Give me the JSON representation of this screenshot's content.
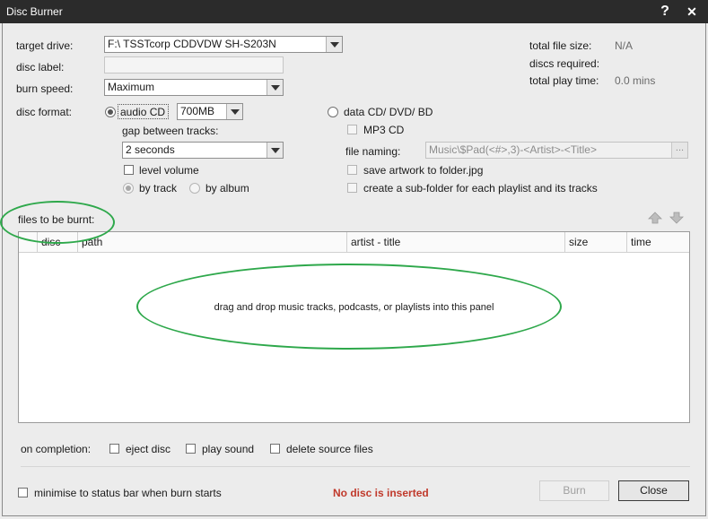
{
  "window": {
    "title": "Disc Burner",
    "help_label": "?",
    "close_label": "✕"
  },
  "left": {
    "target_drive_label": "target drive:",
    "target_drive_value": "F:\\ TSSTcorp CDDVDW SH-S203N",
    "disc_label_label": "disc label:",
    "disc_label_value": "",
    "burn_speed_label": "burn speed:",
    "burn_speed_value": "Maximum",
    "disc_format_label": "disc format:",
    "audio_cd_label": "audio CD",
    "audio_cd_size": "700MB",
    "gap_label": "gap between tracks:",
    "gap_value": "2 seconds",
    "level_volume_label": "level volume",
    "by_track_label": "by track",
    "by_album_label": "by album"
  },
  "right": {
    "total_file_size_label": "total file size:",
    "total_file_size_value": "N/A",
    "discs_required_label": "discs required:",
    "discs_required_value": "",
    "total_play_time_label": "total play time:",
    "total_play_time_value": "0.0 mins",
    "data_cd_label": "data CD/ DVD/ BD",
    "mp3_cd_label": "MP3 CD",
    "file_naming_label": "file naming:",
    "file_naming_value": "Music\\$Pad(<#>,3)-<Artist>-<Title>",
    "file_naming_browse": "...",
    "save_artwork_label": "save artwork to folder.jpg",
    "create_subfolder_label": "create a sub-folder for each playlist and its tracks"
  },
  "files": {
    "label": "files to be burnt:",
    "columns": [
      "disc",
      "path",
      "artist - title",
      "size",
      "time"
    ],
    "empty_message": "drag and drop music tracks, podcasts, or playlists into this panel"
  },
  "completion": {
    "label": "on completion:",
    "eject_label": "eject disc",
    "play_sound_label": "play sound",
    "delete_source_label": "delete source files"
  },
  "footer": {
    "minimise_label": "minimise to status bar when burn starts",
    "status_text": "No disc is inserted",
    "burn_label": "Burn",
    "close_label": "Close"
  },
  "colors": {
    "status": "#c0392b",
    "annotation": "#2ea84b",
    "titlebar": "#2b2b2b"
  }
}
